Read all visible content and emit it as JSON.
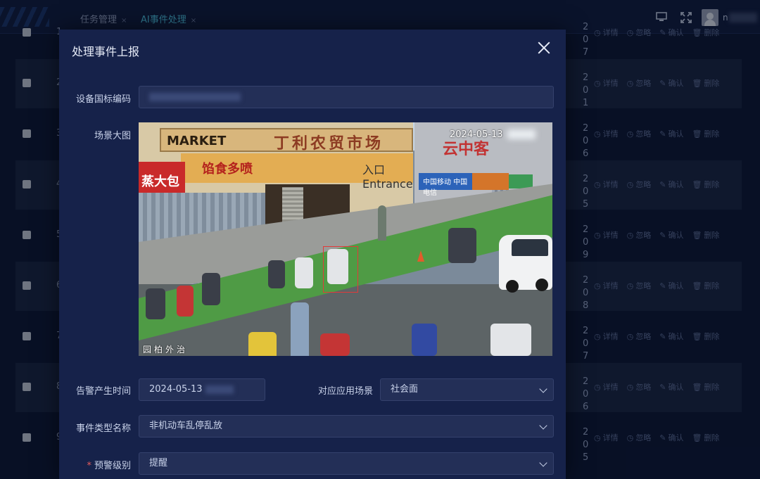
{
  "header": {
    "tabs": [
      {
        "label": "任务管理",
        "close": "×"
      },
      {
        "label": "AI事件处理",
        "close": "×"
      }
    ],
    "username": "n"
  },
  "background_table": {
    "rows": [
      {
        "num": "1",
        "date": "20",
        "date2": "7"
      },
      {
        "num": "2",
        "date": "20",
        "date2": "1"
      },
      {
        "num": "3",
        "date": "20",
        "date2": "6"
      },
      {
        "num": "4",
        "date": "20",
        "date2": "5"
      },
      {
        "num": "5",
        "date": "20",
        "date2": "9"
      },
      {
        "num": "6",
        "date": "20",
        "date2": "8"
      },
      {
        "num": "7",
        "date": "20",
        "date2": "7"
      },
      {
        "num": "8",
        "date": "20",
        "date2": "6"
      },
      {
        "num": "9",
        "date": "20",
        "date2": "5"
      }
    ],
    "actions": [
      "详情",
      "忽略",
      "确认",
      "删除"
    ]
  },
  "modal": {
    "title": "处理事件上报",
    "device_code_label": "设备国标编码",
    "device_code_value": "",
    "scene_label": "场景大图",
    "scene": {
      "osd_time": "2024-05-13",
      "osd_bottom": "园柏外治",
      "sign_market": "MARKET",
      "sign_market_cn": "丁利农贸市场",
      "band_text": "馅食多喷",
      "entrance_text": "入口 Entrance",
      "red_sign": "蒸大包",
      "right_sign": "云中客",
      "blue_sign": "中国移动 中国电信"
    },
    "alarm_time_label": "告警产生时间",
    "alarm_time_value": "2024-05-13",
    "scene_type_label": "对应应用场景",
    "scene_type_value": "社会面",
    "event_type_label": "事件类型名称",
    "event_type_value": "非机动车乱停乱放",
    "level_label": "预警级别",
    "level_required_mark": "*",
    "level_value": "提醒"
  }
}
